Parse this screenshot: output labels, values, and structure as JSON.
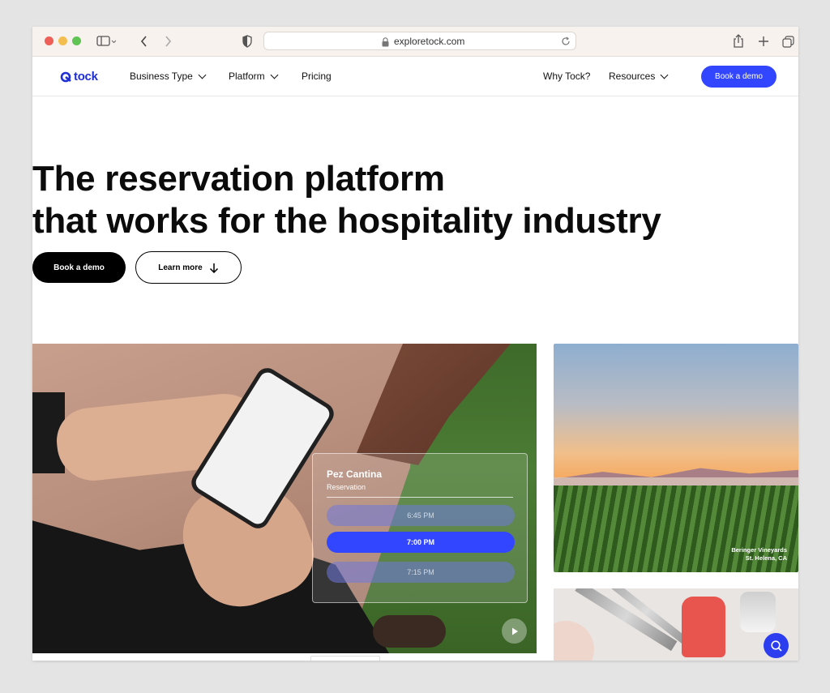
{
  "browser": {
    "url": "exploretock.com",
    "colors": {
      "chrome": "#f7f2ee"
    }
  },
  "nav": {
    "logo_text": "tock",
    "items": [
      {
        "label": "Business Type",
        "has_dropdown": true
      },
      {
        "label": "Platform",
        "has_dropdown": true
      },
      {
        "label": "Pricing",
        "has_dropdown": false
      }
    ],
    "right_items": [
      {
        "label": "Why Tock?",
        "has_dropdown": false
      },
      {
        "label": "Resources",
        "has_dropdown": true
      }
    ],
    "cta_label": "Book a demo",
    "accent_color": "#3346ff"
  },
  "hero": {
    "title_line1": "The reservation platform",
    "title_line2": "that works for the hospitality industry",
    "primary_button": "Book a demo",
    "secondary_button": "Learn more"
  },
  "reservation_card": {
    "venue": "Pez Cantina",
    "subtitle": "Reservation",
    "slots": [
      {
        "time": "6:45 PM",
        "selected": false
      },
      {
        "time": "7:00 PM",
        "selected": true
      },
      {
        "time": "7:15 PM",
        "selected": false
      }
    ]
  },
  "vineyard": {
    "caption_line1": "Beringer Vineyards",
    "caption_line2": "St. Helena, CA"
  },
  "icons": [
    "sidebar-icon",
    "back-icon",
    "forward-icon",
    "shield-icon",
    "lock-icon",
    "reload-icon",
    "share-icon",
    "new-tab-icon",
    "tabs-overview-icon",
    "arrow-down-icon",
    "play-icon",
    "search-icon"
  ]
}
